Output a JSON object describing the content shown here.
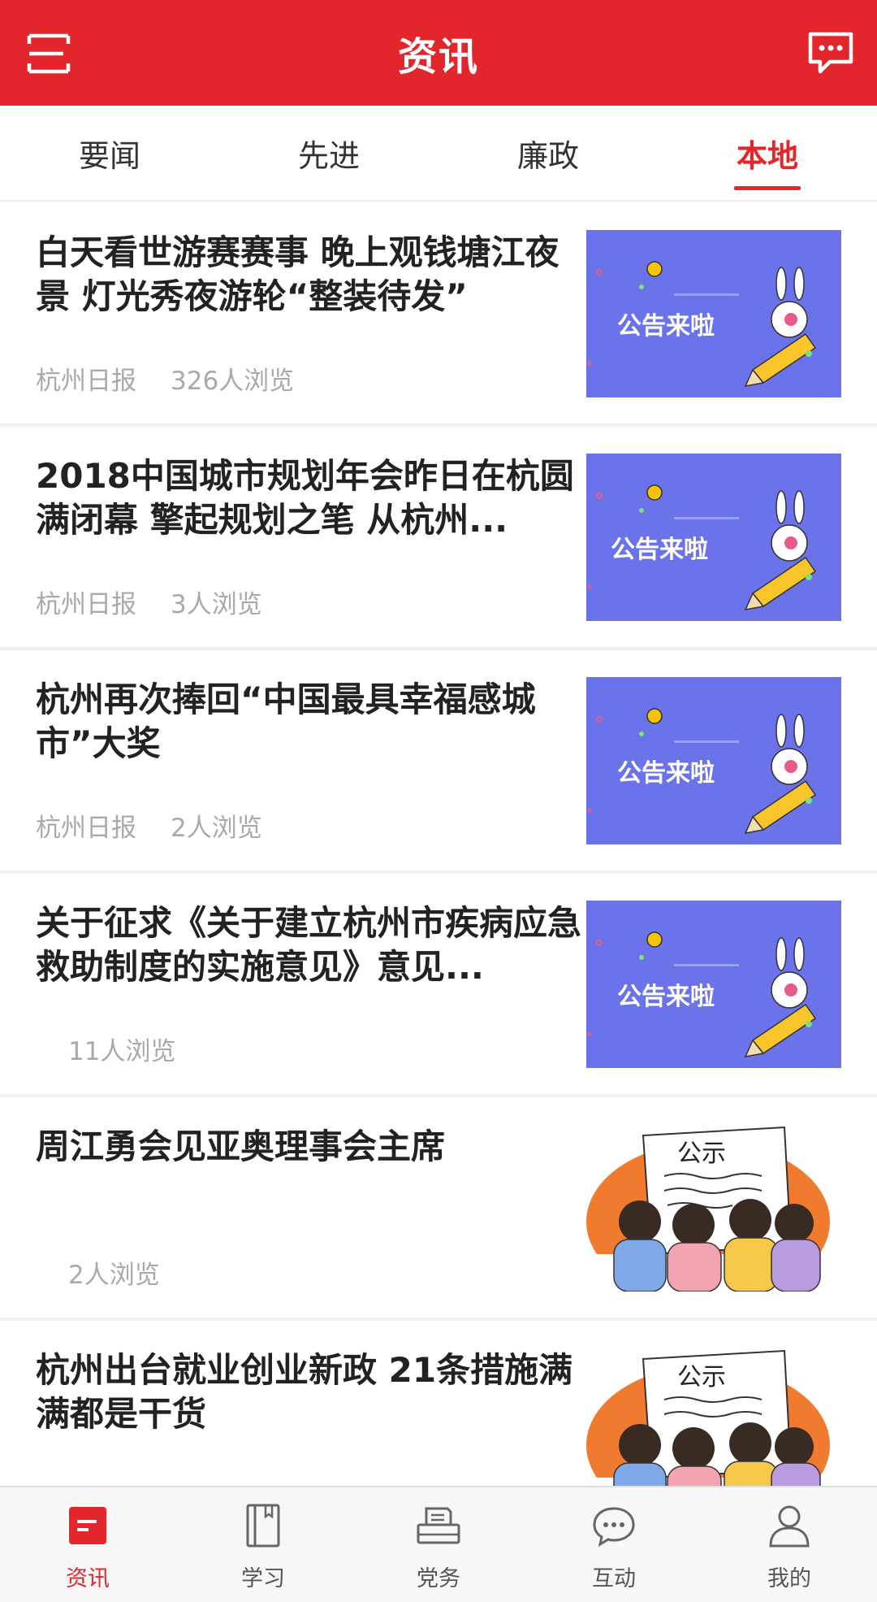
{
  "header": {
    "title": "资讯"
  },
  "tabs": [
    {
      "label": "要闻",
      "active": false
    },
    {
      "label": "先进",
      "active": false
    },
    {
      "label": "廉政",
      "active": false
    },
    {
      "label": "本地",
      "active": true
    }
  ],
  "news": [
    {
      "title": "白天看世游赛赛事 晚上观钱塘江夜景 灯光秀夜游轮“整装待发”",
      "source": "杭州日报",
      "views": "326人浏览",
      "thumb_text": "公告来啦"
    },
    {
      "title": "2018中国城市规划年会昨日在杭圆满闭幕 擎起规划之笔 从杭州...",
      "source": "杭州日报",
      "views": "3人浏览",
      "thumb_text": "公告来啦"
    },
    {
      "title": "杭州再次捧回“中国最具幸福感城市”大奖",
      "source": "杭州日报",
      "views": "2人浏览",
      "thumb_text": "公告来啦"
    },
    {
      "title": "关于征求《关于建立杭州市疾病应急救助制度的实施意见》意见...",
      "source": "",
      "views": "11人浏览",
      "thumb_text": "公告来啦"
    },
    {
      "title": "周江勇会见亚奥理事会主席",
      "source": "",
      "views": "2人浏览",
      "thumb_text": "公示"
    },
    {
      "title": "杭州出台就业创业新政 21条措施满满都是干货",
      "source": "",
      "views": "",
      "thumb_text": "公示"
    }
  ],
  "bottom_nav": [
    {
      "label": "资讯",
      "icon": "news-icon",
      "active": true
    },
    {
      "label": "学习",
      "icon": "book-icon",
      "active": false
    },
    {
      "label": "党务",
      "icon": "printer-icon",
      "active": false
    },
    {
      "label": "互动",
      "icon": "chat-icon",
      "active": false
    },
    {
      "label": "我的",
      "icon": "user-icon",
      "active": false
    }
  ],
  "colors": {
    "brand": "#e3262b",
    "notice_bg": "#6b73ea",
    "publicity_bg": "#f07a2e"
  }
}
